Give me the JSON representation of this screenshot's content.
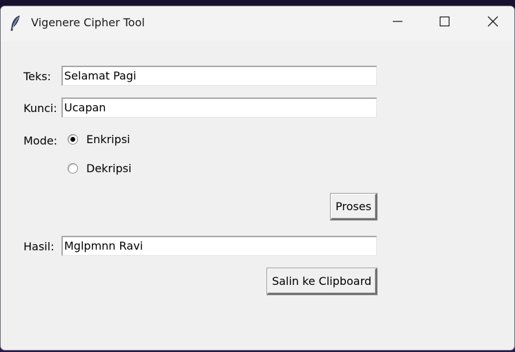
{
  "window": {
    "title": "Vigenere Cipher Tool",
    "app_icon": "feather-icon",
    "controls": {
      "minimize_icon": "minimize-icon",
      "maximize_icon": "maximize-icon",
      "close_icon": "close-icon"
    }
  },
  "form": {
    "text_label": "Teks:",
    "text_value": "Selamat Pagi",
    "key_label": "Kunci:",
    "key_value": "Ucapan",
    "mode_label": "Mode:",
    "mode_options": [
      {
        "label": "Enkripsi",
        "selected": true
      },
      {
        "label": "Dekripsi",
        "selected": false
      }
    ],
    "process_button": "Proses",
    "result_label": "Hasil:",
    "result_value": "Mglpmnn Ravi",
    "copy_button": "Salin ke Clipboard"
  }
}
